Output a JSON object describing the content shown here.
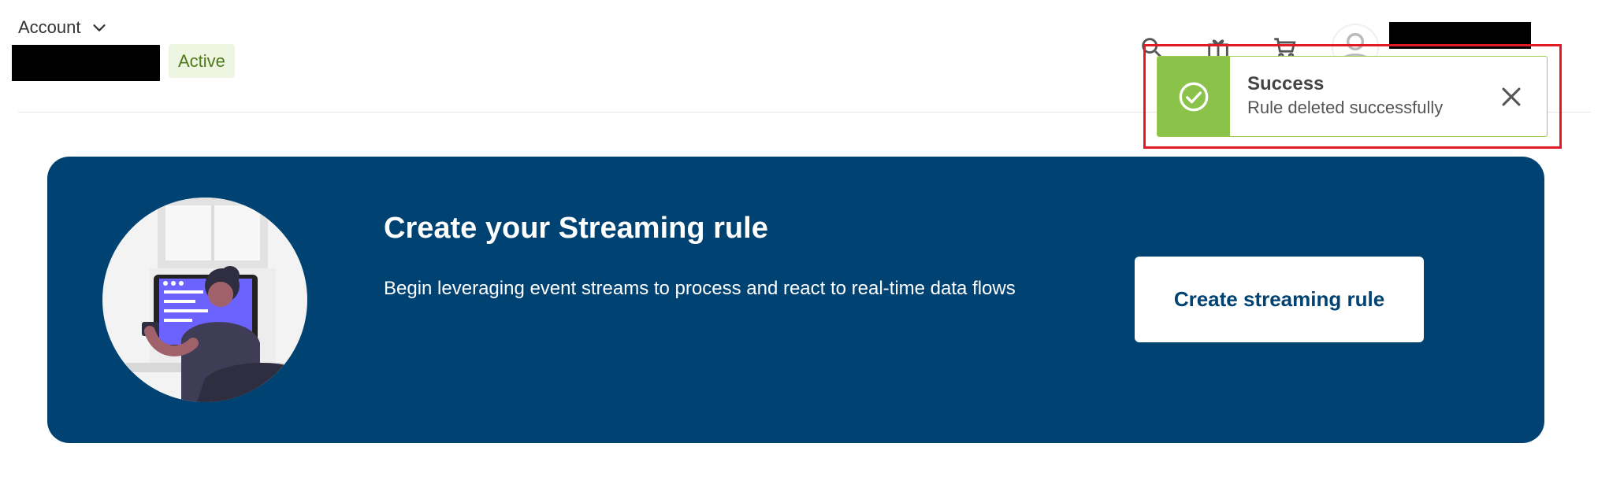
{
  "header": {
    "account_label": "Account",
    "status_badge": "Active"
  },
  "toast": {
    "title": "Success",
    "message": "Rule deleted successfully",
    "colors": {
      "accent": "#8bc34a",
      "border": "#9ccb4d",
      "highlight": "#e01b24"
    }
  },
  "banner": {
    "title": "Create your Streaming rule",
    "description": "Begin leveraging event streams to process and react to real-time data flows",
    "button_label": "Create streaming rule",
    "colors": {
      "background": "#004272",
      "button_bg": "#ffffff"
    }
  },
  "icons": {
    "header": [
      "search-icon",
      "gift-icon",
      "cart-icon",
      "user-icon"
    ],
    "toast": [
      "check-circle-icon",
      "close-icon"
    ],
    "account": [
      "chevron-down-icon"
    ]
  }
}
